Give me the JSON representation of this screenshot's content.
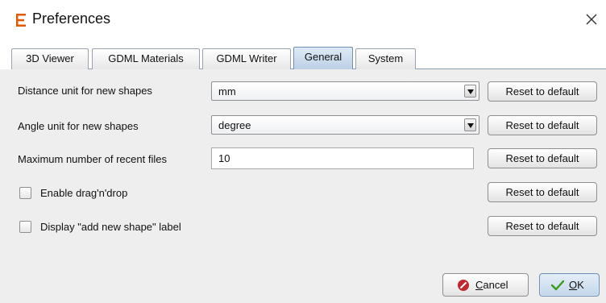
{
  "window": {
    "title": "Preferences",
    "brand_color": "#e05a00",
    "logo_icon": "app-e-logo-icon",
    "close_icon": "close-icon"
  },
  "tabs": [
    {
      "label": "3D Viewer",
      "active": false
    },
    {
      "label": "GDML Materials",
      "active": false
    },
    {
      "label": "GDML Writer",
      "active": false
    },
    {
      "label": "General",
      "active": true
    },
    {
      "label": "System",
      "active": false
    }
  ],
  "general": {
    "distance_unit": {
      "label": "Distance unit for new shapes",
      "value": "mm",
      "reset_label": "Reset to default"
    },
    "angle_unit": {
      "label": "Angle unit for new shapes",
      "value": "degree",
      "reset_label": "Reset to default"
    },
    "max_recent": {
      "label": "Maximum number of recent files",
      "value": "10",
      "reset_label": "Reset to default"
    },
    "drag_drop": {
      "label": "Enable drag'n'drop",
      "checked": false,
      "reset_label": "Reset to default"
    },
    "add_shape_label": {
      "label": "Display \"add new shape\" label",
      "checked": false,
      "reset_label": "Reset to default"
    }
  },
  "footer": {
    "cancel_label": "Cancel",
    "cancel_icon": "cancel-icon",
    "cancel_icon_color": "#c0282d",
    "ok_label": "OK",
    "ok_icon": "checkmark-icon",
    "ok_icon_color": "#3a9a1a"
  }
}
